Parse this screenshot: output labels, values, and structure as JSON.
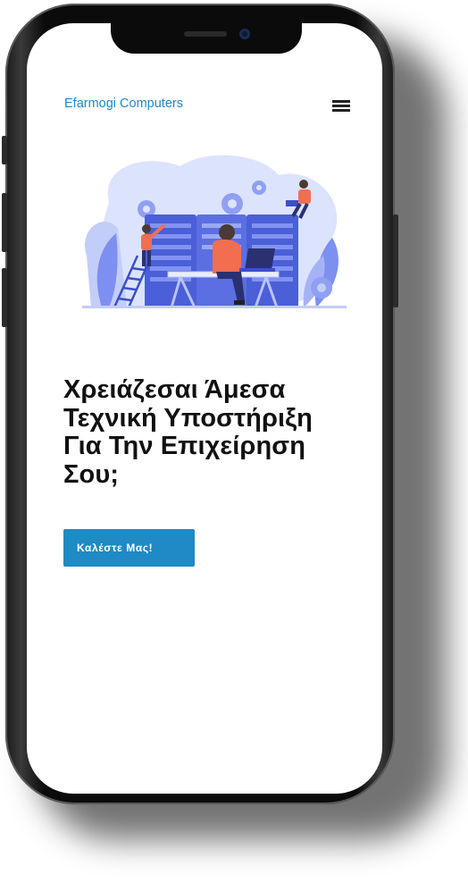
{
  "header": {
    "brand": "Efarmogi Computers",
    "menu_icon": "hamburger-menu-icon"
  },
  "hero": {
    "illustration": "tech-support-illustration",
    "headline": "Χρειάζεσαι Άμεσα Τεχνική Υποστήριξη Για Την Επιχείρηση Σου;",
    "cta_label": "Καλέστε Μας!"
  },
  "colors": {
    "accent": "#1e8ac6",
    "headline": "#111111",
    "illustration_primary": "#4a5fd8",
    "illustration_light": "#c9d4fb",
    "illustration_orange": "#f26e50"
  }
}
